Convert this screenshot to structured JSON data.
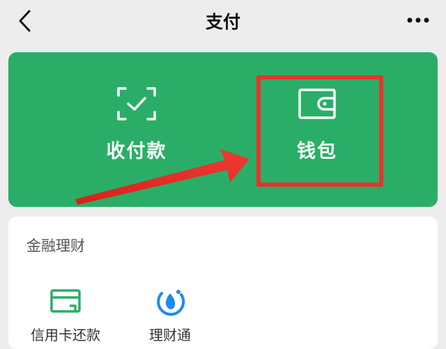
{
  "header": {
    "title": "支付",
    "back_icon": "chevron-left-icon",
    "more_icon": "more-dots-icon"
  },
  "main_card": {
    "background": "#2aae67",
    "actions": [
      {
        "label": "收付款",
        "icon": "scan-check-icon"
      },
      {
        "label": "钱包",
        "icon": "wallet-icon"
      }
    ]
  },
  "annotation": {
    "color": "#e8322c",
    "target": "钱包"
  },
  "finance": {
    "title": "金融理财",
    "items": [
      {
        "label": "信用卡还款",
        "icon": "credit-card-icon"
      },
      {
        "label": "理财通",
        "icon": "wealth-icon"
      }
    ]
  }
}
